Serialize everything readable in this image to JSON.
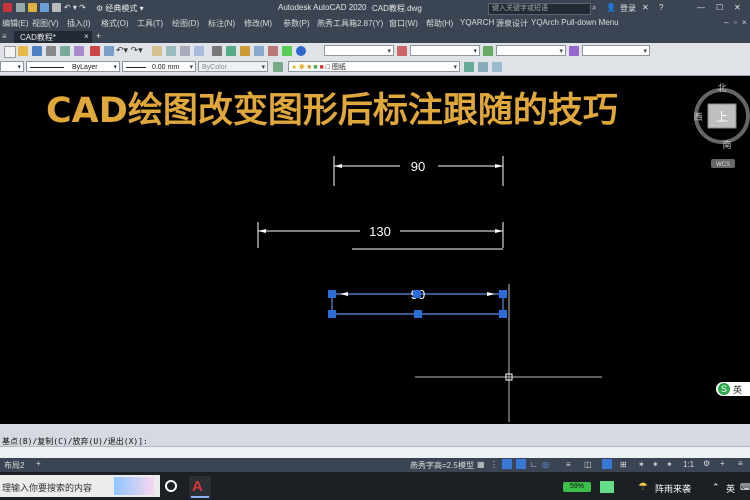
{
  "titlebar": {
    "app_title": "Autodesk AutoCAD 2020",
    "file_name": "CAD教程.dwg",
    "workspace": "经典模式",
    "search_placeholder": "键入关键字或短语",
    "login": "登录"
  },
  "menubar": {
    "items": [
      "编辑(E)",
      "视图(V)",
      "插入(I)",
      "格式(O)",
      "工具(T)",
      "绘图(D)",
      "标注(N)",
      "修改(M)",
      "参数(P)",
      "燕秀工具箱2.87(Y)",
      "窗口(W)",
      "帮助(H)",
      "YQARCH",
      "源泉设计",
      "YQArch Pull-down Menu"
    ]
  },
  "tabs": {
    "doc_tab": "CAD教程*",
    "add": "+"
  },
  "toolbar2": {
    "linetype": "ByLayer",
    "lineweight": "0.00 mm",
    "plotstyle": "ByColor",
    "layer": "图纸"
  },
  "drawing": {
    "title": "CAD绘图改变图形后标注跟随的技巧",
    "dim_top": "90",
    "dim_middle": "130",
    "dim_selected": "90"
  },
  "viewcube": {
    "north": "北",
    "west": "西",
    "south": "南",
    "face": "上",
    "wcs": "WCS"
  },
  "command": {
    "prompt": "基点(B)/复制(C)/放弃(U)/退出(X)]:"
  },
  "status": {
    "layout_tab": "布局2",
    "add": "+",
    "annotation_scale": "燕秀字高=2.5",
    "model": "模型",
    "scale": "1:1"
  },
  "taskbar": {
    "search_placeholder": "理输入你要搜索的内容",
    "weather": "阵雨来袭",
    "ime": "英",
    "battery": "59%"
  },
  "ime_badge": {
    "label": "英"
  },
  "colors": {
    "title_text": "#e0a83a",
    "selection_blue": "#3a78d8",
    "app_dark": "#3b4453"
  }
}
